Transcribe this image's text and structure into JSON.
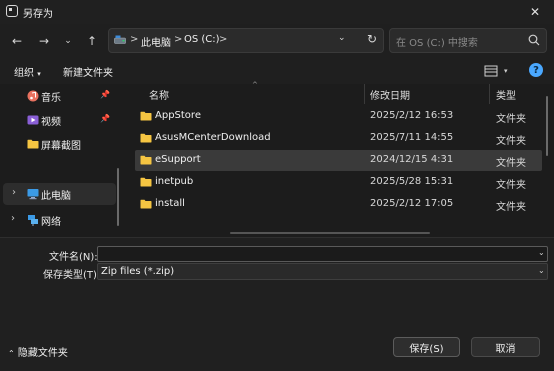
{
  "window": {
    "title": "另存为",
    "close_icon": "close-icon"
  },
  "nav": {
    "breadcrumbs": [
      "此电脑",
      "OS (C:)"
    ],
    "separator": ">",
    "search_placeholder": "在 OS (C:) 中搜索"
  },
  "toolbar": {
    "organize_label": "组织",
    "organize_caret": "▾",
    "new_folder_label": "新建文件夹",
    "help_label": "?"
  },
  "sidebar": {
    "items": [
      {
        "label": "音乐",
        "icon": "music-icon",
        "pinned": true
      },
      {
        "label": "视频",
        "icon": "video-icon",
        "pinned": true
      },
      {
        "label": "屏幕截图",
        "icon": "folder-icon",
        "pinned": false
      },
      {
        "label": "此电脑",
        "icon": "computer-icon",
        "selected": true
      },
      {
        "label": "网络",
        "icon": "network-icon"
      }
    ]
  },
  "filelist": {
    "columns": {
      "name": "名称",
      "date": "修改日期",
      "type": "类型"
    },
    "rows": [
      {
        "name": "AppStore",
        "date": "2025/2/12 16:53",
        "type": "文件夹"
      },
      {
        "name": "AsusMCenterDownload",
        "date": "2025/7/11 14:55",
        "type": "文件夹"
      },
      {
        "name": "eSupport",
        "date": "2024/12/15 4:31",
        "type": "文件夹",
        "selected": true
      },
      {
        "name": "inetpub",
        "date": "2025/5/28 15:31",
        "type": "文件夹"
      },
      {
        "name": "install",
        "date": "2025/2/12 17:05",
        "type": "文件夹"
      }
    ]
  },
  "form": {
    "filename_label": "文件名(N):",
    "filename_value": "",
    "filetype_label": "保存类型(T):",
    "filetype_value": "Zip files (*.zip)"
  },
  "footer": {
    "hide_folders_label": "隐藏文件夹",
    "save_label": "保存(S)",
    "cancel_label": "取消"
  },
  "colors": {
    "accent": "#4aa8ff",
    "folder": "#f5c542",
    "background": "#1c1c1c"
  }
}
